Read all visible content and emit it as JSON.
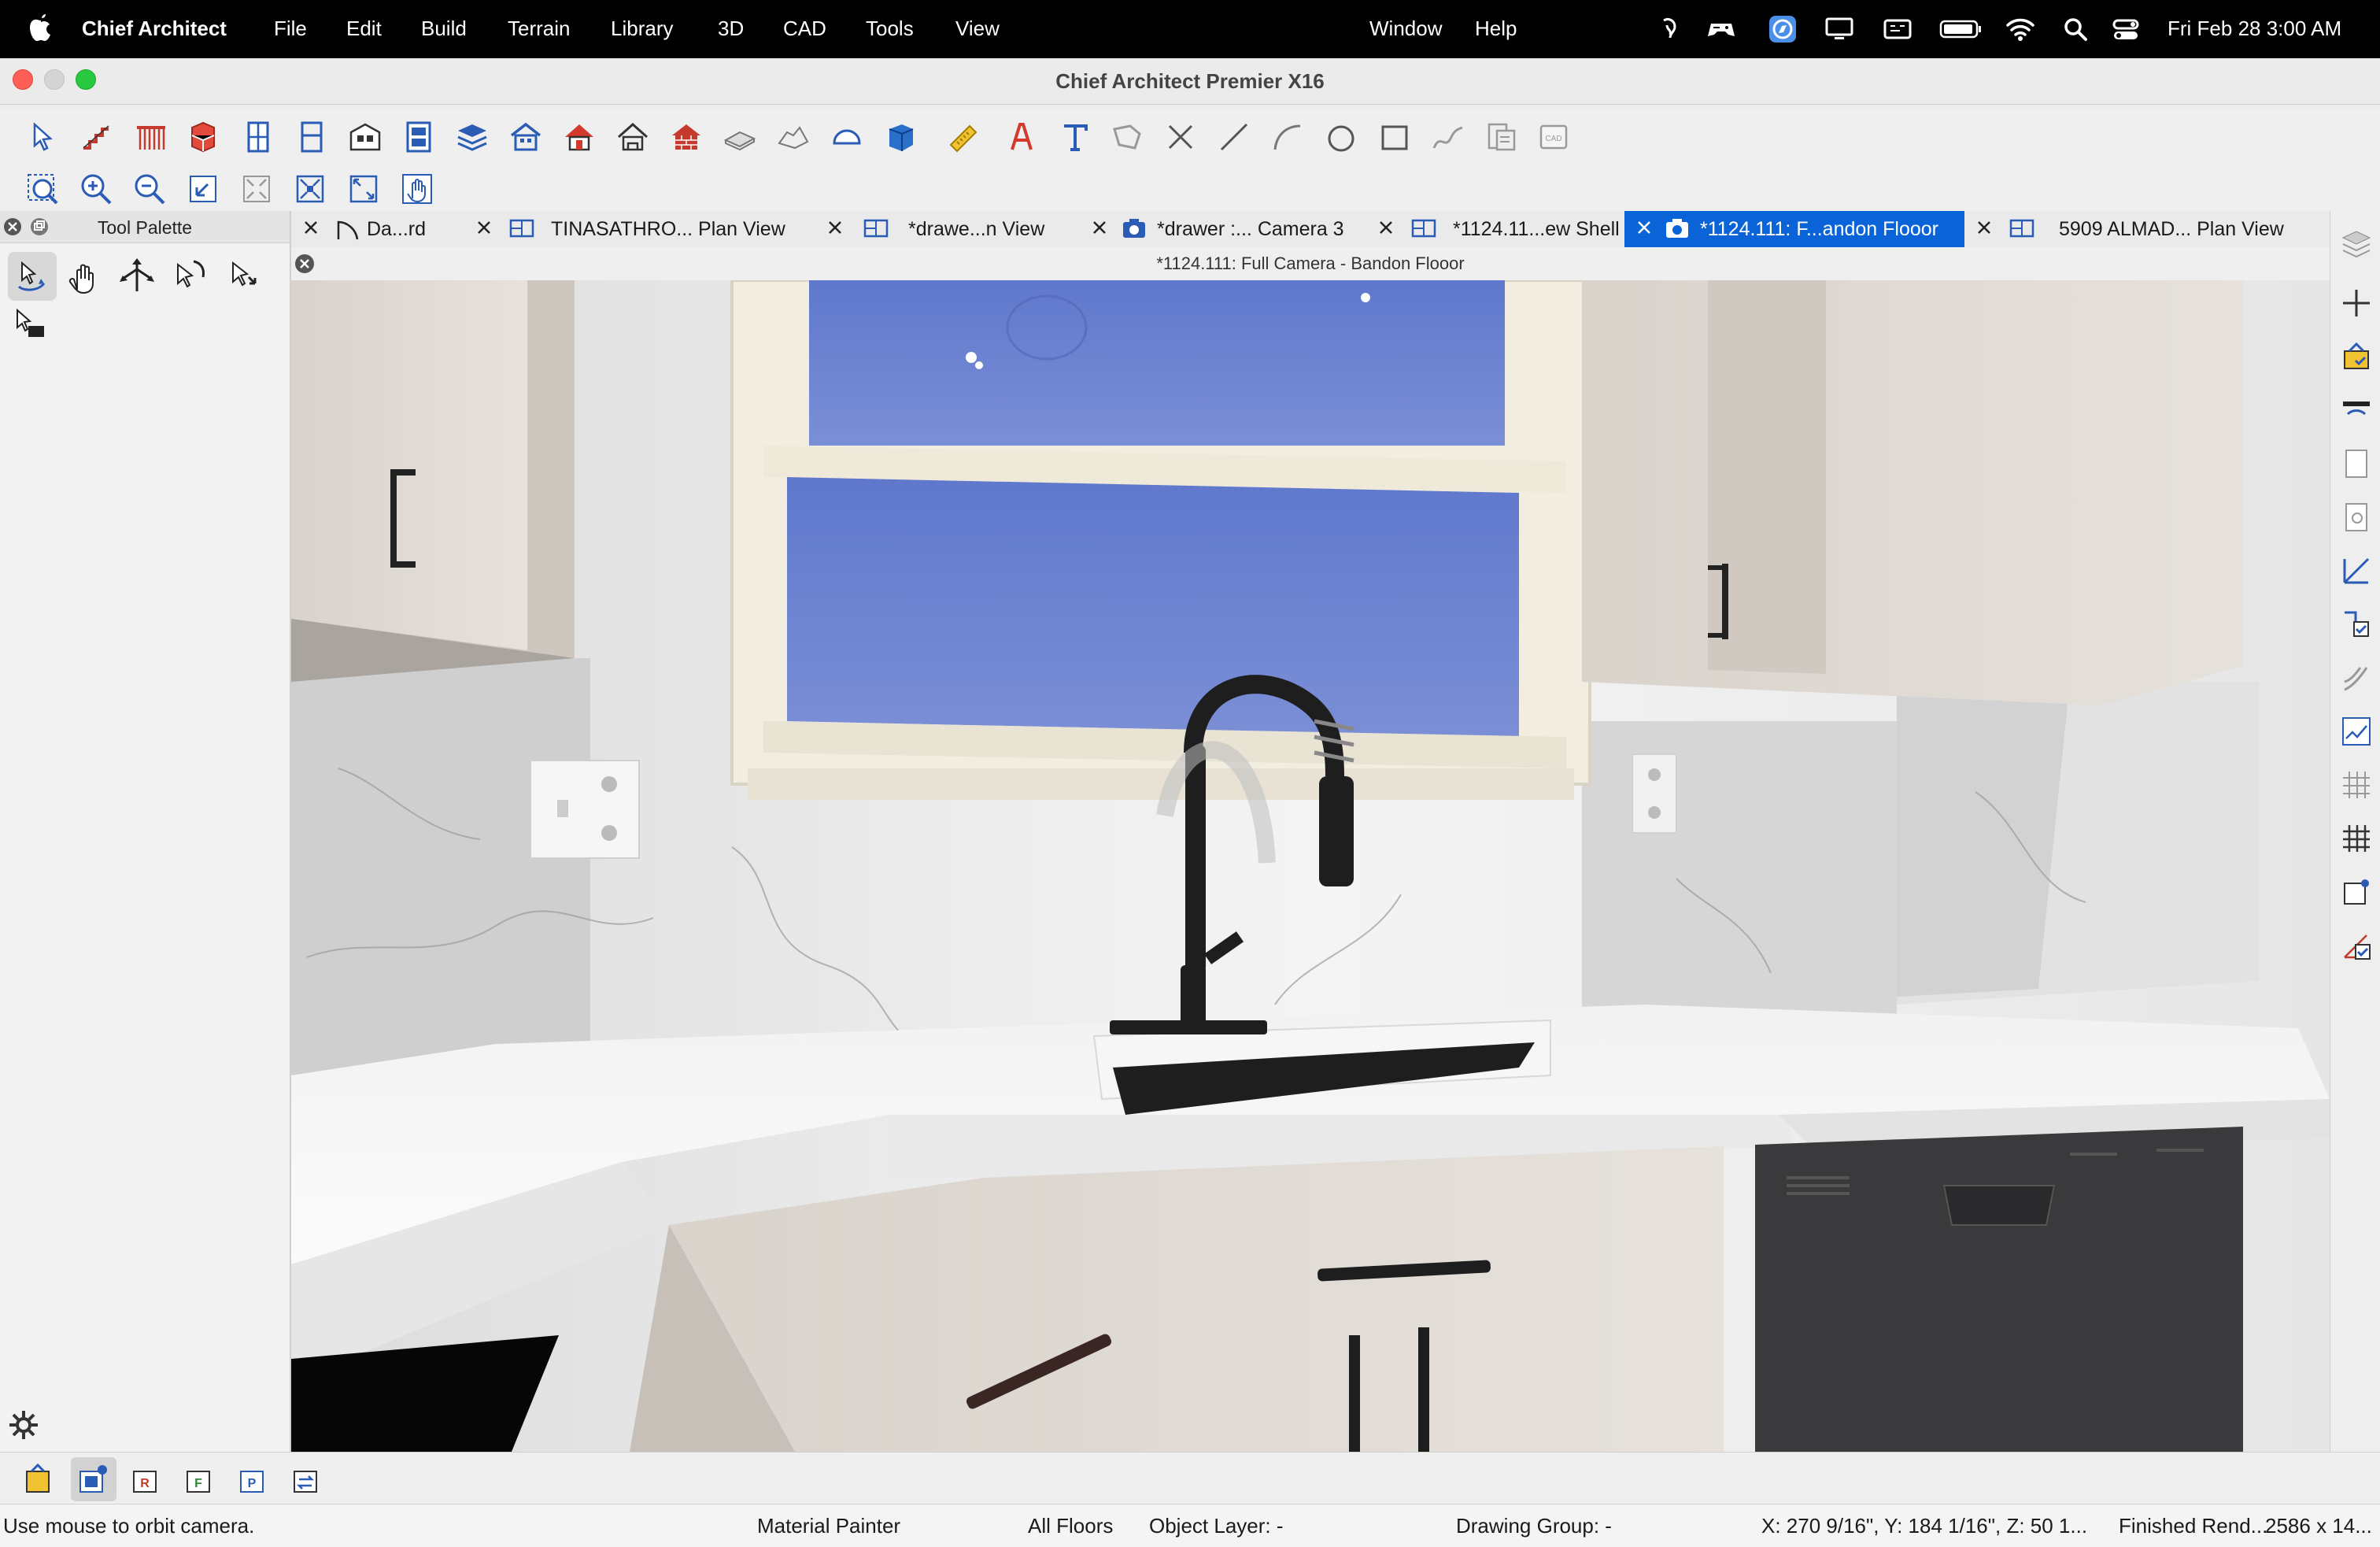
{
  "menubar": {
    "app_name": "Chief Architect",
    "menus": [
      "File",
      "Edit",
      "Build",
      "Terrain",
      "Library",
      "3D",
      "CAD",
      "Tools",
      "View"
    ],
    "right_menus": [
      "Window",
      "Help"
    ],
    "clock": "Fri Feb 28  3:00 AM"
  },
  "window": {
    "title": "Chief Architect Premier X16"
  },
  "palette": {
    "title": "Tool Palette"
  },
  "tabs": [
    {
      "label": "Da...rd",
      "icon": "arc-icon",
      "active": false
    },
    {
      "label": "TINASATHRO... Plan View",
      "icon": "plan-view-icon",
      "active": false
    },
    {
      "label": "*drawe...n View",
      "icon": "plan-view-icon",
      "active": false
    },
    {
      "label": "*drawer :... Camera 3",
      "icon": "camera-icon",
      "active": false
    },
    {
      "label": "*1124.11...ew Shell",
      "icon": "plan-view-icon",
      "active": false
    },
    {
      "label": "*1124.111: F...andon Flooor",
      "icon": "camera-icon",
      "active": true
    },
    {
      "label": "5909 ALMAD... Plan View",
      "icon": "plan-view-icon",
      "active": false
    }
  ],
  "view": {
    "title": "*1124.111: Full Camera - Bandon Flooor"
  },
  "status": {
    "hint": "Use mouse to orbit camera.",
    "tool": "Material Painter",
    "floors": "All Floors",
    "layer": "Object Layer: -",
    "group": "Drawing Group: -",
    "coords": "X: 270 9/16\", Y: 184 1/16\", Z: 50 1...",
    "render": "Finished Rend...",
    "size": "2586 x 14..."
  },
  "colors": {
    "accent": "#0a64d8",
    "cabinet": "#dcd6cf",
    "sky": "#6d82cf",
    "fixture_black": "#1e1e1e"
  }
}
